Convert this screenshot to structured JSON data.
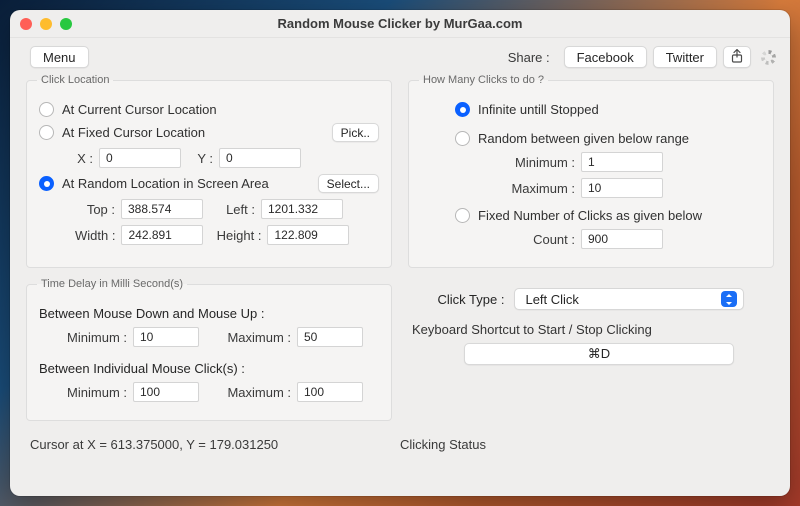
{
  "window": {
    "title": "Random Mouse Clicker by MurGaa.com"
  },
  "toolbar": {
    "menu": "Menu",
    "share_label": "Share :",
    "facebook": "Facebook",
    "twitter": "Twitter"
  },
  "click_location": {
    "legend": "Click Location",
    "current": "At Current Cursor Location",
    "fixed": "At Fixed Cursor Location",
    "pick": "Pick..",
    "x_label": "X :",
    "x_value": "0",
    "y_label": "Y :",
    "y_value": "0",
    "random": "At Random Location in Screen Area",
    "select": "Select...",
    "top_label": "Top :",
    "top_value": "388.574",
    "left_label": "Left :",
    "left_value": "1201.332",
    "width_label": "Width :",
    "width_value": "242.891",
    "height_label": "Height :",
    "height_value": "122.809"
  },
  "time_delay": {
    "legend": "Time Delay in Milli Second(s)",
    "updown_title": "Between Mouse Down and Mouse Up :",
    "min_label": "Minimum :",
    "max_label": "Maximum :",
    "updown_min": "10",
    "updown_max": "50",
    "between_title": "Between Individual Mouse Click(s) :",
    "between_min": "100",
    "between_max": "100"
  },
  "how_many": {
    "legend": "How Many Clicks to do ?",
    "infinite": "Infinite untill Stopped",
    "random_range": "Random between given below range",
    "min_label": "Minimum :",
    "min_value": "1",
    "max_label": "Maximum :",
    "max_value": "10",
    "fixed": "Fixed Number of Clicks as given below",
    "count_label": "Count :",
    "count_value": "900"
  },
  "click_type": {
    "label": "Click Type :",
    "value": "Left Click"
  },
  "shortcut": {
    "label": "Keyboard Shortcut to Start / Stop Clicking",
    "value": "⌘D"
  },
  "footer": {
    "cursor": "Cursor at X = 613.375000, Y = 179.031250",
    "status": "Clicking Status"
  }
}
